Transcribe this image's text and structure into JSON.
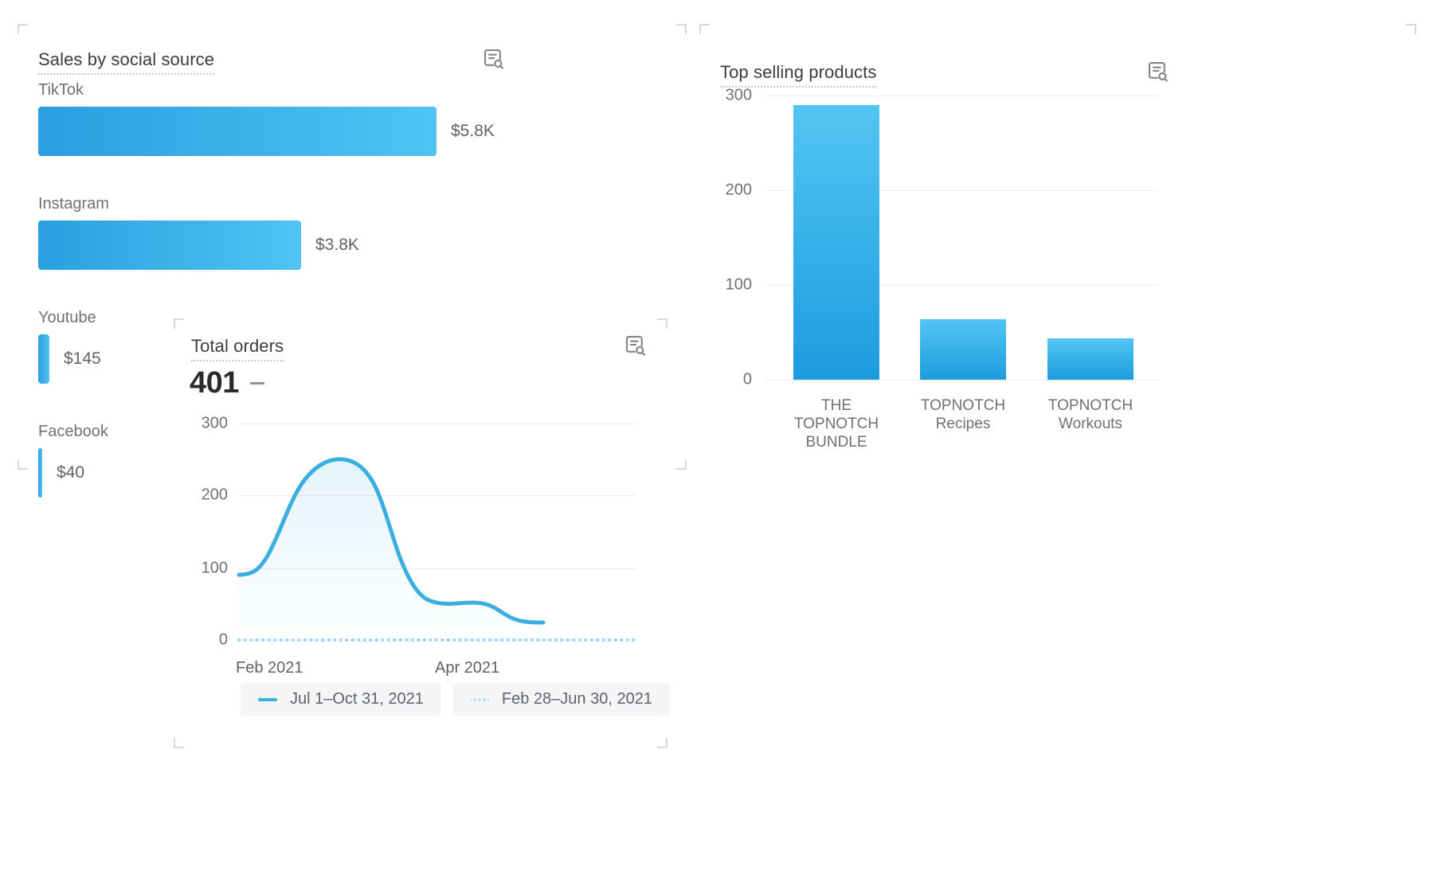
{
  "sales_card": {
    "title": "Sales by social source",
    "report_icon": "report-search-icon",
    "rows": [
      {
        "label": "TikTok",
        "value_text": "$5.8K",
        "value": 5800
      },
      {
        "label": "Instagram",
        "value_text": "$3.8K",
        "value": 3800
      },
      {
        "label": "Youtube",
        "value_text": "$145",
        "value": 145
      },
      {
        "label": "Facebook",
        "value_text": "$40",
        "value": 40
      }
    ]
  },
  "orders_card": {
    "title": "Total orders",
    "report_icon": "report-search-icon",
    "metric_value": "401",
    "change_indicator": "no-change-dash",
    "legend": [
      {
        "label": "Jul 1–Oct 31, 2021",
        "style": "solid"
      },
      {
        "label": "Feb 28–Jun 30, 2021",
        "style": "dotted"
      }
    ],
    "yticks": [
      "300",
      "200",
      "100",
      "0"
    ],
    "xticks": [
      "Feb 2021",
      "Apr 2021"
    ]
  },
  "top_card": {
    "title": "Top selling products",
    "report_icon": "report-search-icon",
    "yticks": [
      "300",
      "200",
      "100",
      "0"
    ],
    "categories": [
      "THE\nTOPNOTCH\nBUNDLE",
      "TOPNOTCH\nRecipes",
      "TOPNOTCH\nWorkouts"
    ]
  },
  "colors": {
    "bar_blue_light": "#53c5f3",
    "bar_blue_dark": "#1c9cdf",
    "line_blue": "#3aaee0",
    "compare_blue": "#9fd8f2",
    "text_gray": "#6d7175",
    "title_gray": "#3c3c3c",
    "gridline": "#ececec"
  },
  "chart_data": [
    {
      "type": "bar",
      "title": "Sales by social source",
      "orientation": "horizontal",
      "categories": [
        "TikTok",
        "Instagram",
        "Youtube",
        "Facebook"
      ],
      "values": [
        5800,
        3800,
        145,
        40
      ],
      "value_labels": [
        "$5.8K",
        "$3.8K",
        "$145",
        "$40"
      ],
      "xlabel": "",
      "ylabel": "",
      "xlim": [
        0,
        5800
      ],
      "grid": false,
      "legend": "none"
    },
    {
      "type": "line",
      "title": "Total orders",
      "metric": 401,
      "x": [
        "Feb 2021",
        "Apr 2021"
      ],
      "xticks": [
        "Feb 2021",
        "Apr 2021"
      ],
      "yticks": [
        0,
        100,
        200,
        300
      ],
      "ylim": [
        0,
        300
      ],
      "ylabel": "",
      "xlabel": "",
      "grid": true,
      "legend": "bottom",
      "series": [
        {
          "name": "Jul 1–Oct 31, 2021",
          "style": "solid",
          "filled": true,
          "values": [
            92,
            110,
            165,
            215,
            232,
            228,
            180,
            95,
            55,
            52,
            50,
            38,
            26,
            24
          ]
        },
        {
          "name": "Feb 28–Jun 30, 2021",
          "style": "dotted",
          "filled": false,
          "values": [
            0,
            0,
            0,
            0,
            0,
            0,
            0,
            0,
            0,
            0,
            0,
            0,
            0,
            0
          ]
        }
      ]
    },
    {
      "type": "bar",
      "title": "Top selling products",
      "orientation": "vertical",
      "categories": [
        "THE TOPNOTCH BUNDLE",
        "TOPNOTCH Recipes",
        "TOPNOTCH Workouts"
      ],
      "values": [
        290,
        64,
        44
      ],
      "yticks": [
        0,
        100,
        200,
        300
      ],
      "ylim": [
        0,
        300
      ],
      "xlabel": "",
      "ylabel": "",
      "grid": true,
      "legend": "none"
    }
  ]
}
